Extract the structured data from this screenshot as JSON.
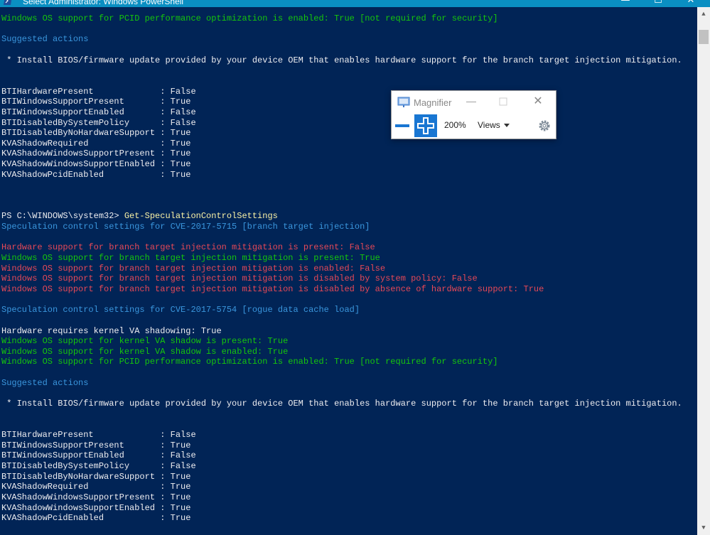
{
  "window": {
    "title": "Select Administrator: Windows PowerShell",
    "controls": {
      "minimize": "—",
      "maximize": "☐",
      "close": "✕"
    }
  },
  "console": {
    "colors": {
      "background": "#012456",
      "white": "#eeedf0",
      "green": "#16c60c",
      "cyan": "#3a96dd",
      "red": "#e74856",
      "yellow": "#f9f1a5"
    },
    "lines": [
      {
        "text": "Windows OS support for PCID performance optimization is enabled: True [not required for security]",
        "color": "green"
      },
      {
        "text": "",
        "color": "white"
      },
      {
        "text": "Suggested actions",
        "color": "cyan"
      },
      {
        "text": "",
        "color": "white"
      },
      {
        "text": " * Install BIOS/firmware update provided by your device OEM that enables hardware support for the branch target injection mitigation.",
        "color": "white"
      },
      {
        "text": "",
        "color": "white"
      },
      {
        "text": "",
        "color": "white"
      },
      {
        "text": "BTIHardwarePresent             : False",
        "color": "white"
      },
      {
        "text": "BTIWindowsSupportPresent       : True",
        "color": "white"
      },
      {
        "text": "BTIWindowsSupportEnabled       : False",
        "color": "white"
      },
      {
        "text": "BTIDisabledBySystemPolicy      : False",
        "color": "white"
      },
      {
        "text": "BTIDisabledByNoHardwareSupport : True",
        "color": "white"
      },
      {
        "text": "KVAShadowRequired              : True",
        "color": "white"
      },
      {
        "text": "KVAShadowWindowsSupportPresent : True",
        "color": "white"
      },
      {
        "text": "KVAShadowWindowsSupportEnabled : True",
        "color": "white"
      },
      {
        "text": "KVAShadowPcidEnabled           : True",
        "color": "white"
      },
      {
        "text": "",
        "color": "white"
      },
      {
        "text": "",
        "color": "white"
      },
      {
        "text": "",
        "color": "white"
      },
      {
        "prompt": "PS C:\\WINDOWS\\system32> ",
        "command": "Get-SpeculationControlSettings"
      },
      {
        "text": "Speculation control settings for CVE-2017-5715 [branch target injection]",
        "color": "cyan"
      },
      {
        "text": "",
        "color": "white"
      },
      {
        "text": "Hardware support for branch target injection mitigation is present: False",
        "color": "red"
      },
      {
        "text": "Windows OS support for branch target injection mitigation is present: True",
        "color": "green"
      },
      {
        "text": "Windows OS support for branch target injection mitigation is enabled: False",
        "color": "red"
      },
      {
        "text": "Windows OS support for branch target injection mitigation is disabled by system policy: False",
        "color": "red"
      },
      {
        "text": "Windows OS support for branch target injection mitigation is disabled by absence of hardware support: True",
        "color": "red"
      },
      {
        "text": "",
        "color": "white"
      },
      {
        "text": "Speculation control settings for CVE-2017-5754 [rogue data cache load]",
        "color": "cyan"
      },
      {
        "text": "",
        "color": "white"
      },
      {
        "text": "Hardware requires kernel VA shadowing: True",
        "color": "white"
      },
      {
        "text": "Windows OS support for kernel VA shadow is present: True",
        "color": "green"
      },
      {
        "text": "Windows OS support for kernel VA shadow is enabled: True",
        "color": "green"
      },
      {
        "text": "Windows OS support for PCID performance optimization is enabled: True [not required for security]",
        "color": "green"
      },
      {
        "text": "",
        "color": "white"
      },
      {
        "text": "Suggested actions",
        "color": "cyan"
      },
      {
        "text": "",
        "color": "white"
      },
      {
        "text": " * Install BIOS/firmware update provided by your device OEM that enables hardware support for the branch target injection mitigation.",
        "color": "white"
      },
      {
        "text": "",
        "color": "white"
      },
      {
        "text": "",
        "color": "white"
      },
      {
        "text": "BTIHardwarePresent             : False",
        "color": "white"
      },
      {
        "text": "BTIWindowsSupportPresent       : True",
        "color": "white"
      },
      {
        "text": "BTIWindowsSupportEnabled       : False",
        "color": "white"
      },
      {
        "text": "BTIDisabledBySystemPolicy      : False",
        "color": "white"
      },
      {
        "text": "BTIDisabledByNoHardwareSupport : True",
        "color": "white"
      },
      {
        "text": "KVAShadowRequired              : True",
        "color": "white"
      },
      {
        "text": "KVAShadowWindowsSupportPresent : True",
        "color": "white"
      },
      {
        "text": "KVAShadowWindowsSupportEnabled : True",
        "color": "white"
      },
      {
        "text": "KVAShadowPcidEnabled           : True",
        "color": "white"
      }
    ]
  },
  "magnifier": {
    "title": "Magnifier",
    "zoom": "200%",
    "views_label": "Views",
    "accent": "#1976d2",
    "icons": [
      "magnifier-app-icon",
      "zoom-out-icon",
      "zoom-in-icon",
      "gear-icon"
    ]
  }
}
